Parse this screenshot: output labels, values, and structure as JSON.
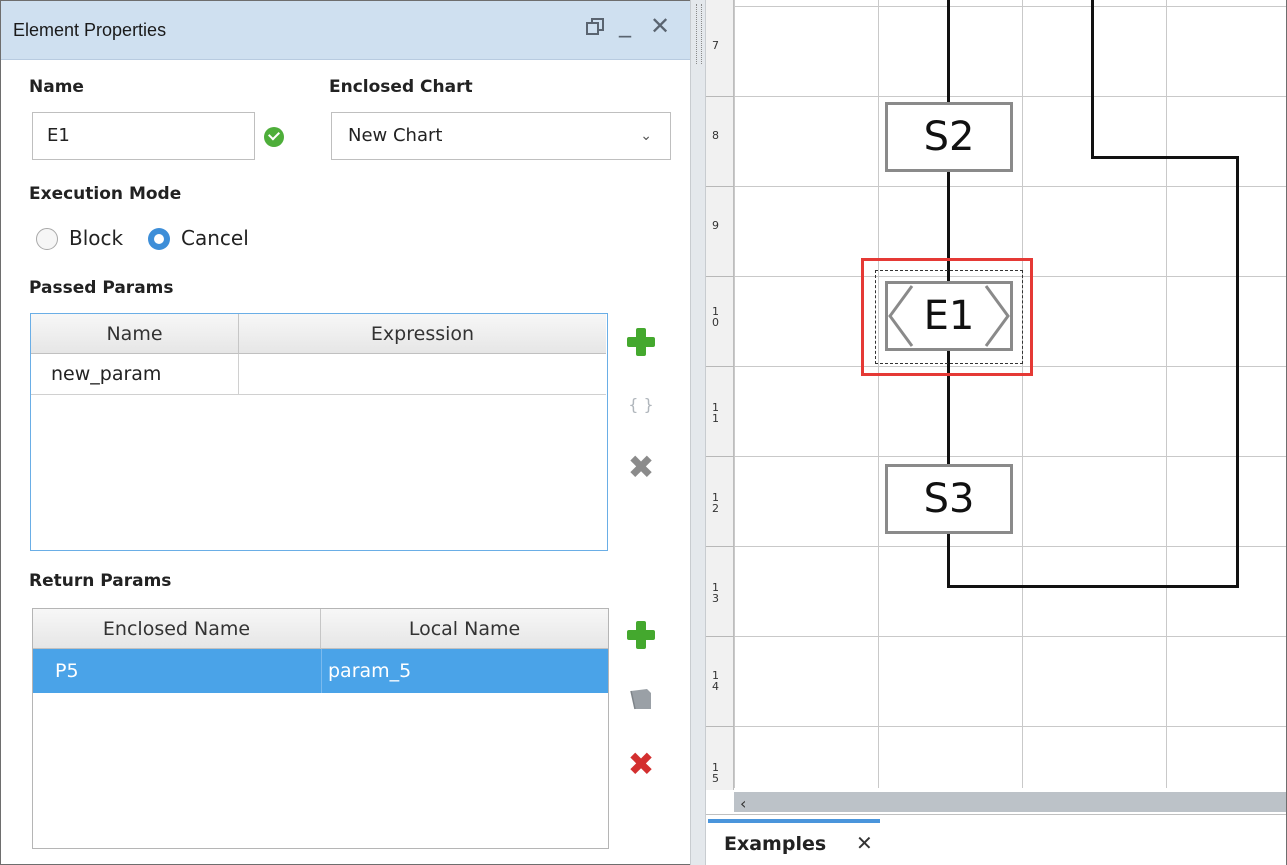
{
  "panel": {
    "title": "Element Properties",
    "name_label": "Name",
    "name_value": "E1",
    "enclosed_chart_label": "Enclosed Chart",
    "enclosed_chart_value": "New Chart",
    "execution_mode_label": "Execution Mode",
    "mode_options": [
      "Block",
      "Cancel"
    ],
    "mode_selected": "Cancel",
    "passed_params": {
      "label": "Passed Params",
      "columns": [
        "Name",
        "Expression"
      ],
      "rows": [
        [
          "new_param",
          ""
        ]
      ]
    },
    "return_params": {
      "label": "Return Params",
      "columns": [
        "Enclosed Name",
        "Local Name"
      ],
      "rows": [
        [
          "P5",
          "param_5"
        ]
      ]
    }
  },
  "ruler": {
    "ticks": [
      "7",
      "8",
      "9",
      "1\n0",
      "1\n1",
      "1\n2",
      "1\n3",
      "1\n4",
      "1\n5"
    ]
  },
  "chart": {
    "steps": [
      "S2",
      "E1",
      "S3"
    ]
  },
  "tabs": [
    {
      "label": "Examples"
    }
  ],
  "colors": {
    "title_bar": "#cfe0f0",
    "selection": "#4aa3e8",
    "highlight_border": "#e53935",
    "add_green": "#44a82e",
    "delete_red": "#d32f2f"
  }
}
